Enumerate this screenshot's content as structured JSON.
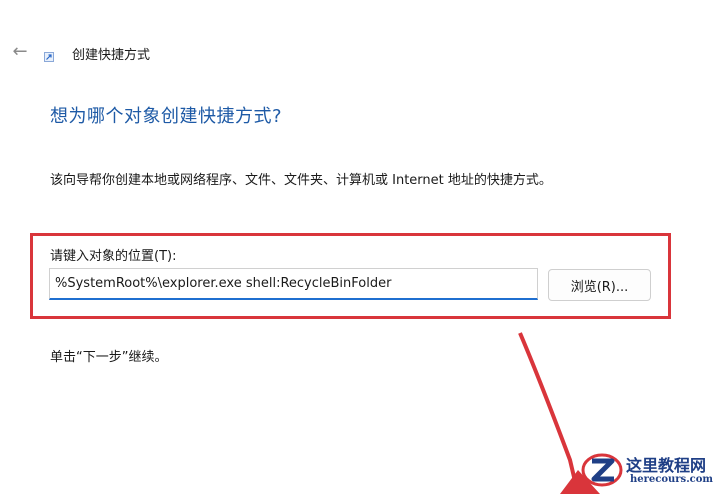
{
  "window": {
    "back_icon": "arrow-left-icon",
    "app_icon": "shortcut-icon",
    "title": "创建快捷方式"
  },
  "main": {
    "heading": "想为哪个对象创建快捷方式?",
    "description": "该向导帮你创建本地或网络程序、文件、文件夹、计算机或 Internet 地址的快捷方式。",
    "location_label": "请键入对象的位置(T):",
    "location_value": "%SystemRoot%\\explorer.exe shell:RecycleBinFolder",
    "browse_label": "浏览(R)...",
    "next_hint": "单击“下一步”继续。"
  },
  "annotation": {
    "highlight_color": "#d9353b",
    "arrow_color": "#d9353b"
  },
  "watermark": {
    "title": "这里教程网",
    "url": "herecours.com"
  }
}
